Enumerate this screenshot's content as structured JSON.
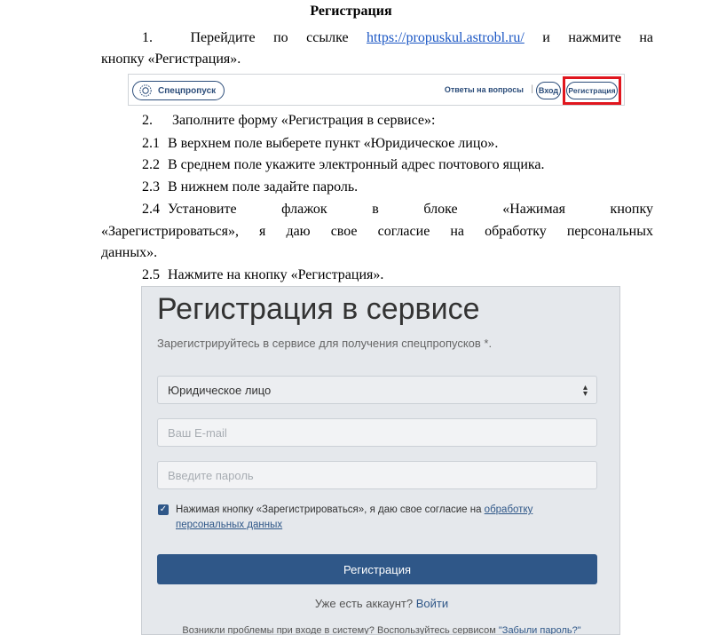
{
  "doc": {
    "title": "Регистрация",
    "step1_num": "1.",
    "step1_text_a": "Перейдите по ссылке",
    "step1_link": "https://propuskul.astrobl.ru/",
    "step1_text_b": "и нажмите на",
    "step1_cont": "кнопку «Регистрация».",
    "step2_num": "2.",
    "step2_text": "Заполните форму «Регистрация в сервисе»:",
    "s21_num": "2.1",
    "s21_text": "В верхнем поле выберете пункт «Юридическое лицо».",
    "s22_num": "2.2",
    "s22_text": "В среднем поле укажите электронный адрес почтового ящика.",
    "s23_num": "2.3",
    "s23_text": "В нижнем поле задайте пароль.",
    "s24_num": "2.4",
    "s24_text": "Установите флажок в блоке «Нажимая кнопку",
    "s24_cont1": "«Зарегистрироваться», я даю свое согласие на обработку персональных",
    "s24_cont2": "данных».",
    "s25_num": "2.5",
    "s25_text": "Нажмите на кнопку «Регистрация»."
  },
  "header_strip": {
    "logo_label": "Спецпропуск",
    "faq": "Ответы на вопросы",
    "separator": "|",
    "login": "Вход",
    "register": "Регистрация"
  },
  "form": {
    "title": "Регистрация в сервисе",
    "subtitle": "Зарегистрируйтесь в сервисе для получения спецпропусков *.",
    "type_selected": "Юридическое лицо",
    "email_placeholder": "Ваш E-mail",
    "password_placeholder": "Введите пароль",
    "consent_text": "Нажимая кнопку «Зарегистрироваться», я даю свое согласие на ",
    "consent_link": "обработку персональных данных",
    "submit": "Регистрация",
    "have_account": "Уже есть аккаунт?",
    "login_link": "Войти",
    "trouble_text": "Возникли проблемы при входе в систему? Воспользуйтесь сервисом ",
    "forgot_link": "\"Забыли пароль?\""
  },
  "colors": {
    "accent": "#2f5788",
    "highlight": "#e0161e",
    "link": "#1a56c4"
  },
  "icons": {
    "logo": "gear-badge-icon",
    "select_caret": "sort-arrows-icon",
    "checkbox": "check-icon"
  }
}
